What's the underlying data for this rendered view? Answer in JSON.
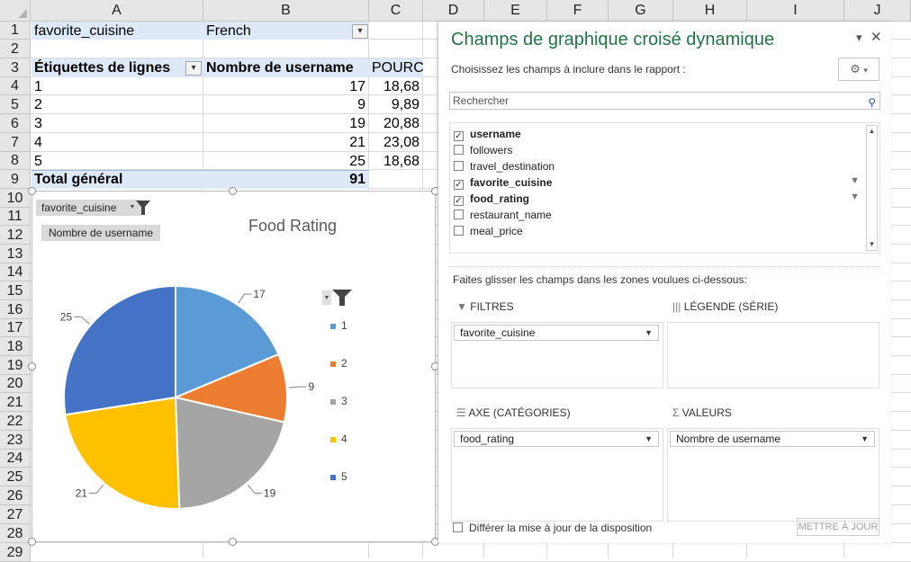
{
  "columns": [
    "A",
    "B",
    "C",
    "D",
    "E",
    "F",
    "G",
    "H",
    "I",
    "J"
  ],
  "rows": [
    "1",
    "2",
    "3",
    "4",
    "5",
    "6",
    "7",
    "8",
    "9",
    "10",
    "11",
    "12",
    "13",
    "14",
    "15",
    "16",
    "17",
    "18",
    "19",
    "20",
    "21",
    "22",
    "23",
    "24",
    "25",
    "26",
    "27",
    "28",
    "29"
  ],
  "pivot": {
    "filter_field": "favorite_cuisine",
    "filter_value": "French",
    "row_label_header": "Étiquettes de lignes",
    "count_header": "Nombre de username",
    "pct_header": "POURC",
    "rows": [
      {
        "label": "1",
        "count": "17",
        "pct": "18,68"
      },
      {
        "label": "2",
        "count": "9",
        "pct": "9,89"
      },
      {
        "label": "3",
        "count": "19",
        "pct": "20,88"
      },
      {
        "label": "4",
        "count": "21",
        "pct": "23,08"
      },
      {
        "label": "5",
        "count": "25",
        "pct": "18,68"
      }
    ],
    "total_label": "Total général",
    "total_count": "91"
  },
  "chart": {
    "filter_button": "favorite_cuisine",
    "value_button": "Nombre de username",
    "legend_filter_icon": "filter-icon"
  },
  "chart_data": {
    "type": "pie",
    "title": "Food Rating",
    "categories": [
      "1",
      "2",
      "3",
      "4",
      "5"
    ],
    "values": [
      17,
      9,
      19,
      21,
      25
    ],
    "colors": [
      "#5b9bd5",
      "#ed7d31",
      "#a5a5a5",
      "#ffc000",
      "#4472c4"
    ],
    "legend": "right"
  },
  "pane": {
    "title": "Champs de graphique croisé dynamique",
    "subtitle": "Choisissez les champs à inclure dans le rapport :",
    "search_placeholder": "Rechercher",
    "fields": [
      {
        "name": "username",
        "checked": true,
        "bold": true,
        "filtered": false
      },
      {
        "name": "followers",
        "checked": false,
        "bold": false,
        "filtered": false
      },
      {
        "name": "travel_destination",
        "checked": false,
        "bold": false,
        "filtered": false
      },
      {
        "name": "favorite_cuisine",
        "checked": true,
        "bold": true,
        "filtered": true
      },
      {
        "name": "food_rating",
        "checked": true,
        "bold": true,
        "filtered": true
      },
      {
        "name": "restaurant_name",
        "checked": false,
        "bold": false,
        "filtered": false
      },
      {
        "name": "meal_price",
        "checked": false,
        "bold": false,
        "filtered": false
      }
    ],
    "drag_hint": "Faites glisser les champs dans les zones voulues ci-dessous:",
    "zones": {
      "filters_label": "FILTRES",
      "filters_item": "favorite_cuisine",
      "legend_label": "LÉGENDE (SÉRIE)",
      "axis_label": "AXE (CATÉGORIES)",
      "axis_item": "food_rating",
      "values_label": "VALEURS",
      "values_item": "Nombre de username"
    },
    "defer_label": "Différer la mise à jour de la disposition",
    "update_button": "METTRE À JOUR"
  }
}
